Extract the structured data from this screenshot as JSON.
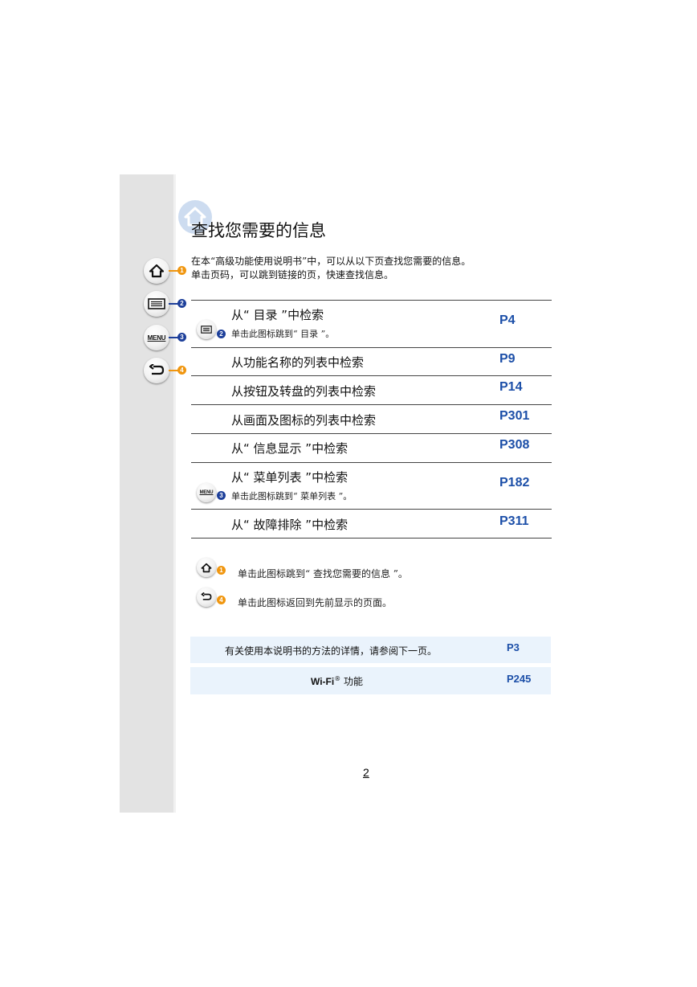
{
  "title": "查找您需要的信息",
  "intro": {
    "line1": "在本“高级功能使用说明书”中，可以从以下页查找您需要的信息。",
    "line2": "单击页码，可以跳到链接的页，快速查找信息。"
  },
  "sidebar": {
    "menu_label": "MENU",
    "badges": [
      "1",
      "2",
      "3",
      "4"
    ]
  },
  "rows": [
    {
      "title": "从“ 目录 ”中检索",
      "sub": "单击此图标跳到“ 目录 ”。",
      "page": "P4",
      "badge": "2"
    },
    {
      "title": "从功能名称的列表中检索",
      "page": "P9"
    },
    {
      "title": "从按钮及转盘的列表中检索",
      "page": "P14"
    },
    {
      "title": "从画面及图标的列表中检索",
      "page": "P301"
    },
    {
      "title": "从“ 信息显示 ”中检索",
      "page": "P308"
    },
    {
      "title": "从“ 菜单列表 ”中检索",
      "sub": "单击此图标跳到“ 菜单列表 ”。",
      "page": "P182",
      "badge": "3",
      "menu_label": "MENU"
    },
    {
      "title": "从“ 故障排除 ”中检索",
      "page": "P311"
    }
  ],
  "legend": [
    {
      "badge": "1",
      "text": "单击此图标跳到“ 查找您需要的信息 ”。"
    },
    {
      "badge": "4",
      "text": "单击此图标返回到先前显示的页面。"
    }
  ],
  "boxes": [
    {
      "text": "有关使用本说明书的方法的详情，请参阅下一页。",
      "page": "P3"
    },
    {
      "text_prefix": "Wi-Fi",
      "sup": "®",
      "text_suffix": " 功能",
      "page": "P245"
    }
  ],
  "page_number": "2",
  "colors": {
    "accent_orange": "#f0960f",
    "accent_blue": "#1d3f9a",
    "link_blue": "#1c4fa8",
    "box_bg": "#eaf3fc",
    "sidebar_bg": "#e3e3e3"
  },
  "icons": [
    "home-icon",
    "list-icon",
    "menu-icon",
    "back-arrow-icon"
  ]
}
